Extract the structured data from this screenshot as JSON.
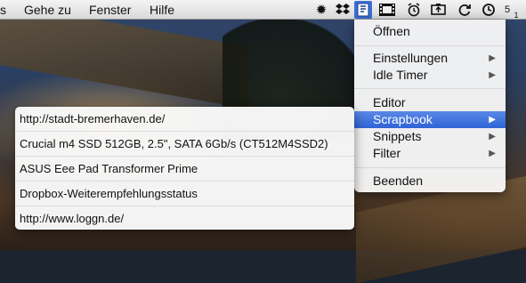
{
  "menubar": {
    "items": [
      {
        "label": "s"
      },
      {
        "label": "Gehe zu"
      },
      {
        "label": "Fenster"
      },
      {
        "label": "Hilfe"
      }
    ],
    "status_icons": [
      {
        "name": "gear-icon",
        "glyph": "✹"
      },
      {
        "name": "dropbox-icon",
        "glyph": "❖"
      },
      {
        "name": "scrapbook-app-icon",
        "glyph": "▣"
      },
      {
        "name": "film-icon",
        "glyph": "▦"
      },
      {
        "name": "alarm-clock-icon",
        "glyph": "⏰"
      },
      {
        "name": "battery-icon",
        "glyph": "▭"
      },
      {
        "name": "sync-icon",
        "glyph": "⟳"
      },
      {
        "name": "time-machine-icon",
        "glyph": "◷"
      }
    ],
    "status_numbers": [
      "5",
      "1"
    ]
  },
  "main_menu": {
    "items": [
      {
        "label": "Öffnen",
        "has_submenu": false
      },
      {
        "label": "Einstellungen",
        "has_submenu": true
      },
      {
        "label": "Idle Timer",
        "has_submenu": true
      },
      {
        "label": "Editor",
        "has_submenu": false
      },
      {
        "label": "Scrapbook",
        "has_submenu": true,
        "selected": true
      },
      {
        "label": "Snippets",
        "has_submenu": true
      },
      {
        "label": "Filter",
        "has_submenu": true
      },
      {
        "label": "Beenden",
        "has_submenu": false
      }
    ],
    "submenu_arrow": "▶",
    "accent_color": "#2f64d6"
  },
  "scrapbook_submenu": {
    "items": [
      {
        "label": "http://stadt-bremerhaven.de/"
      },
      {
        "label": "Crucial m4 SSD 512GB, 2.5\", SATA 6Gb/s (CT512M4SSD2)"
      },
      {
        "label": "ASUS Eee Pad Transformer Prime"
      },
      {
        "label": "Dropbox-Weiterempfehlungsstatus"
      },
      {
        "label": "http://www.loggn.de/"
      }
    ]
  }
}
